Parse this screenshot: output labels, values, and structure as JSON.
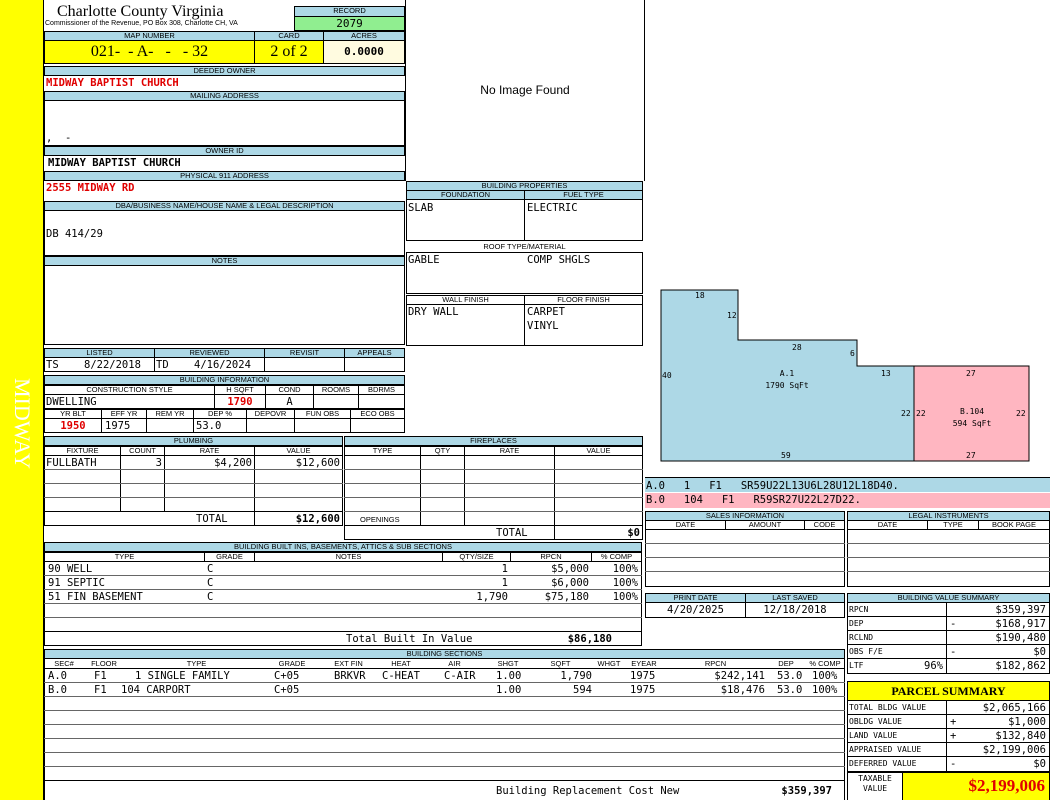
{
  "side_label": "MIDWAY",
  "county": {
    "title": "Charlotte County Virginia",
    "subtitle": "Commissioner of the Revenue, PO Box 308, Charlotte CH, VA"
  },
  "record": {
    "label": "RECORD",
    "value": "2079"
  },
  "map": {
    "label": "MAP NUMBER",
    "value": "021-  - A-   -   - 32",
    "card_label": "CARD",
    "card": "2 of 2",
    "acres_label": "ACRES",
    "acres": "0.0000"
  },
  "deeded_owner": {
    "label": "DEEDED OWNER",
    "value": "MIDWAY BAPTIST CHURCH"
  },
  "mailing": {
    "label": "MAILING ADDRESS",
    "line": ",  -"
  },
  "owner_id": {
    "label": "OWNER ID",
    "value": "MIDWAY BAPTIST CHURCH"
  },
  "physical": {
    "label": "PHYSICAL 911 ADDRESS",
    "value": "2555 MIDWAY RD"
  },
  "dba": {
    "label": "DBA/BUSINESS NAME/HOUSE NAME & LEGAL DESCRIPTION",
    "value": "DB 414/29"
  },
  "notes": {
    "label": "NOTES"
  },
  "image": {
    "text": "No Image Found"
  },
  "listing": {
    "listed_label": "LISTED",
    "listed_by": "TS",
    "listed_date": "8/22/2018",
    "reviewed_label": "REVIEWED",
    "reviewed_by": "TD",
    "reviewed_date": "4/16/2024",
    "revisit_label": "REVISIT",
    "appeals_label": "APPEALS"
  },
  "building_info": {
    "title": "BUILDING INFORMATION",
    "h_construction": "CONSTRUCTION STYLE",
    "h_hsqft": "H SQFT",
    "h_cond": "COND",
    "h_rooms": "ROOMS",
    "h_bdrms": "BDRMS",
    "construction": "DWELLING",
    "hsqft": "1790",
    "cond": "A",
    "h_yrblt": "YR BLT",
    "h_effyr": "EFF YR",
    "h_remyr": "REM YR",
    "h_dep": "DEP %",
    "h_depovr": "DEPOVR",
    "h_funobs": "FUN OBS",
    "h_ecoobs": "ECO OBS",
    "yrblt": "1950",
    "effyr": "1975",
    "dep": "53.0"
  },
  "plumbing": {
    "title": "PLUMBING",
    "h_fixture": "FIXTURE",
    "h_count": "COUNT",
    "h_rate": "RATE",
    "h_value": "VALUE",
    "fixture": "FULLBATH",
    "count": "3",
    "rate": "$4,200",
    "value": "$12,600",
    "total_label": "TOTAL",
    "total": "$12,600"
  },
  "fireplaces": {
    "title": "FIREPLACES",
    "h_type": "TYPE",
    "h_qty": "QTY",
    "h_rate": "RATE",
    "h_value": "VALUE",
    "openings_label": "OPENINGS",
    "total_label": "TOTAL",
    "total": "$0"
  },
  "building_properties": {
    "title": "BUILDING PROPERTIES",
    "h_foundation": "FOUNDATION",
    "h_fuel": "FUEL TYPE",
    "foundation": "SLAB",
    "fuel": "ELECTRIC",
    "h_roof": "ROOF TYPE/MATERIAL",
    "roof_type": "GABLE",
    "roof_material": "COMP SHGLS",
    "h_wall": "WALL FINISH",
    "h_floor": "FLOOR FINISH",
    "wall": "DRY WALL",
    "floor1": "CARPET",
    "floor2": "VINYL"
  },
  "sketch": {
    "a_label": "A.1",
    "a_area": "1790 SqFt",
    "b_label": "B.104",
    "b_area": "594 SqFt",
    "dims": {
      "d18": "18",
      "d12": "12",
      "d28": "28",
      "d6": "6",
      "d13": "13",
      "d40": "40",
      "d22a": "22",
      "d22b": "22",
      "d22c": "22",
      "d59": "59",
      "d27a": "27",
      "d27b": "27"
    },
    "colors": {
      "a": "#add8e6",
      "b": "#ffb6c1"
    }
  },
  "sketch_codes": {
    "a": "A.0   1   F1   SR59U22L13U6L28U12L18D40.",
    "b": "B.0   104   F1   R59SR27U22L27D22."
  },
  "builtins": {
    "title": "BUILDING BUILT INS, BASEMENTS, ATTICS & SUB SECTIONS",
    "h_type": "TYPE",
    "h_grade": "GRADE",
    "h_notes": "NOTES",
    "h_qty": "QTY/SIZE",
    "h_rpcn": "RPCN",
    "h_comp": "% COMP",
    "rows": [
      {
        "type": "90 WELL",
        "grade": "C",
        "qty": "1",
        "rpcn": "$5,000",
        "comp": "100%"
      },
      {
        "type": "91 SEPTIC",
        "grade": "C",
        "qty": "1",
        "rpcn": "$6,000",
        "comp": "100%"
      },
      {
        "type": "51 FIN BASEMENT",
        "grade": "C",
        "qty": "1,790",
        "rpcn": "$75,180",
        "comp": "100%"
      }
    ],
    "total_label": "Total Built In Value",
    "total": "$86,180"
  },
  "sections": {
    "title": "BUILDING SECTIONS",
    "h_sec": "SEC#",
    "h_floor": "FLOOR",
    "h_type": "TYPE",
    "h_grade": "GRADE",
    "h_extfin": "EXT FIN",
    "h_heat": "HEAT",
    "h_air": "AIR",
    "h_shgt": "SHGT",
    "h_sqft": "SQFT",
    "h_whgt": "WHGT",
    "h_eyear": "EYEAR",
    "h_rpcn": "RPCN",
    "h_dep": "DEP",
    "h_comp": "% COMP",
    "rows": [
      {
        "sec": "A.0",
        "floor": "F1",
        "type": "1 SINGLE FAMILY",
        "grade": "C+05",
        "extfin": "BRKVR",
        "heat": "C-HEAT",
        "air": "C-AIR",
        "shgt": "1.00",
        "sqft": "1,790",
        "eyear": "1975",
        "rpcn": "$242,141",
        "dep": "53.0",
        "comp": "100%"
      },
      {
        "sec": "B.0",
        "floor": "F1",
        "type": "104 CARPORT",
        "grade": "C+05",
        "extfin": "",
        "heat": "",
        "air": "",
        "shgt": "1.00",
        "sqft": "594",
        "eyear": "1975",
        "rpcn": "$18,476",
        "dep": "53.0",
        "comp": "100%"
      }
    ],
    "total_label": "Building Replacement Cost New",
    "total": "$359,397"
  },
  "sales": {
    "title": "SALES INFORMATION",
    "h_date": "DATE",
    "h_amount": "AMOUNT",
    "h_code": "CODE"
  },
  "legal": {
    "title": "LEGAL INSTRUMENTS",
    "h_date": "DATE",
    "h_type": "TYPE",
    "h_book": "BOOK PAGE"
  },
  "print": {
    "print_label": "PRINT DATE",
    "print_date": "4/20/2025",
    "saved_label": "LAST SAVED",
    "saved_date": "12/18/2018"
  },
  "value_summary": {
    "title": "BUILDING VALUE SUMMARY",
    "rows": [
      {
        "label": "RPCN",
        "op": "",
        "value": "$359,397"
      },
      {
        "label": "DEP",
        "op": "-",
        "value": "$168,917"
      },
      {
        "label": "RCLND",
        "op": "",
        "value": "$190,480"
      },
      {
        "label": "OBS F/E",
        "op": "-",
        "value": "$0"
      },
      {
        "label": "LTF",
        "op": "96%",
        "value": "$182,862"
      }
    ]
  },
  "parcel_summary": {
    "title": "PARCEL SUMMARY",
    "rows": [
      {
        "label": "TOTAL BLDG VALUE",
        "op": "",
        "value": "$2,065,166"
      },
      {
        "label": "OBLDG VALUE",
        "op": "+",
        "value": "$1,000"
      },
      {
        "label": "LAND VALUE",
        "op": "+",
        "value": "$132,840"
      },
      {
        "label": "APPRAISED VALUE",
        "op": "",
        "value": "$2,199,006"
      },
      {
        "label": "DEFERRED VALUE",
        "op": "-",
        "value": "$0"
      }
    ],
    "taxable_label1": "TAXABLE",
    "taxable_label2": "VALUE",
    "taxable": "$2,199,006"
  }
}
